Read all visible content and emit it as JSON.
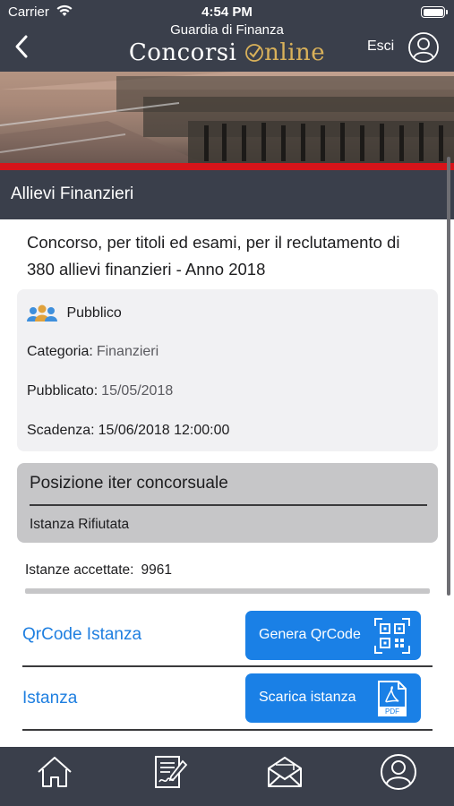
{
  "status_bar": {
    "carrier": "Carrier",
    "time": "4:54 PM"
  },
  "header": {
    "subtitle": "Guardia di Finanza",
    "title_part1": "Concorsi ",
    "title_part2": "nline",
    "exit_label": "Esci",
    "icons": {
      "back": "chevron-left-icon",
      "user": "user-circle-icon",
      "check_o": "check-circle-icon"
    }
  },
  "section": {
    "title": "Allievi Finanzieri"
  },
  "competition": {
    "title": "Concorso, per titoli ed esami, per il reclutamento di 380 allievi finanzieri - Anno 2018",
    "visibility": "Pubblico",
    "category_label": "Categoria:",
    "category_value": "Finanzieri",
    "published_label": "Pubblicato:",
    "published_value": "15/05/2018",
    "deadline_label": "Scadenza:",
    "deadline_value": "15/06/2018 12:00:00"
  },
  "position": {
    "title": "Posizione iter concorsuale",
    "value": "Istanza Rifiutata"
  },
  "accepted": {
    "label": "Istanze accettate:",
    "value": "9961"
  },
  "actions": {
    "qr_label": "QrCode Istanza",
    "qr_button": "Genera QrCode",
    "istanza_label": "Istanza",
    "istanza_button": "Scarica istanza",
    "pdf_text": "PDF"
  },
  "tabbar": {
    "icons": [
      "home-icon",
      "document-sign-icon",
      "mail-icon",
      "user-circle-icon"
    ]
  },
  "colors": {
    "bar": "#3a3f4b",
    "accent": "#1a80e6",
    "red": "#d6141a",
    "link": "#1f7fe0",
    "gold": "#d9b15a"
  }
}
